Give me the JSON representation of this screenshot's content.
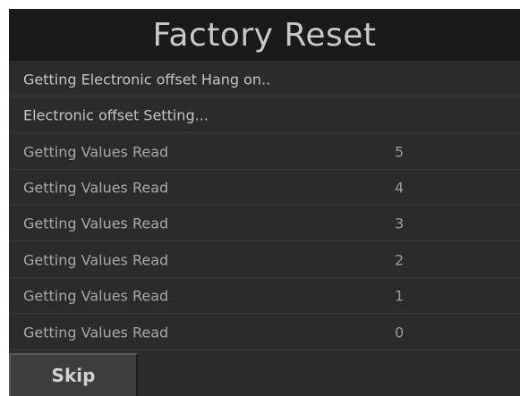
{
  "title": "Factory Reset",
  "status_lines": [
    "Getting Electronic offset Hang on..",
    "Electronic offset Setting..."
  ],
  "readings": [
    {
      "label": "Getting Values Read",
      "value": "5"
    },
    {
      "label": "Getting Values Read",
      "value": "4"
    },
    {
      "label": "Getting Values Read",
      "value": "3"
    },
    {
      "label": "Getting Values Read",
      "value": "2"
    },
    {
      "label": "Getting Values Read",
      "value": "1"
    },
    {
      "label": "Getting Values Read",
      "value": "0"
    }
  ],
  "skip_label": "Skip",
  "colors": {
    "background": "#2b2b2b",
    "title_bar": "#1a1a1a",
    "text": "#b2b2b2",
    "button": "#3d3d3d"
  }
}
